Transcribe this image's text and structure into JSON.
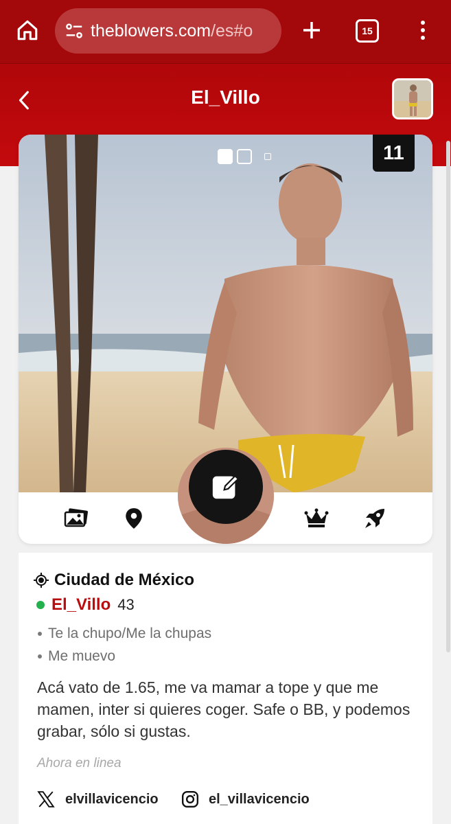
{
  "browser": {
    "url_main": "theblowers.com",
    "url_rest": "/es#o",
    "tab_count": "15"
  },
  "header": {
    "title": "El_Villo"
  },
  "photo": {
    "count": "11"
  },
  "profile": {
    "location": "Ciudad de México",
    "username": "El_Villo",
    "age": "43",
    "tags": [
      "Te la chupo/Me la chupas",
      "Me muevo"
    ],
    "bio": "Acá vato de 1.65, me va mamar a tope y que me mamen, inter si quieres coger. Safe o BB, y podemos grabar, sólo si gustas.",
    "status": "Ahora en linea",
    "social": {
      "x": "elvillavicencio",
      "instagram": "el_villavicencio"
    }
  },
  "colors": {
    "brand_red": "#b0070a",
    "online_green": "#22b14c"
  },
  "icons": [
    "home-icon",
    "site-settings-icon",
    "plus-icon",
    "tabs-icon",
    "more-vert-icon",
    "back-icon",
    "gallery-icon",
    "location-pin-icon",
    "edit-icon",
    "crown-icon",
    "rocket-icon",
    "crosshair-icon",
    "x-logo-icon",
    "instagram-icon"
  ]
}
